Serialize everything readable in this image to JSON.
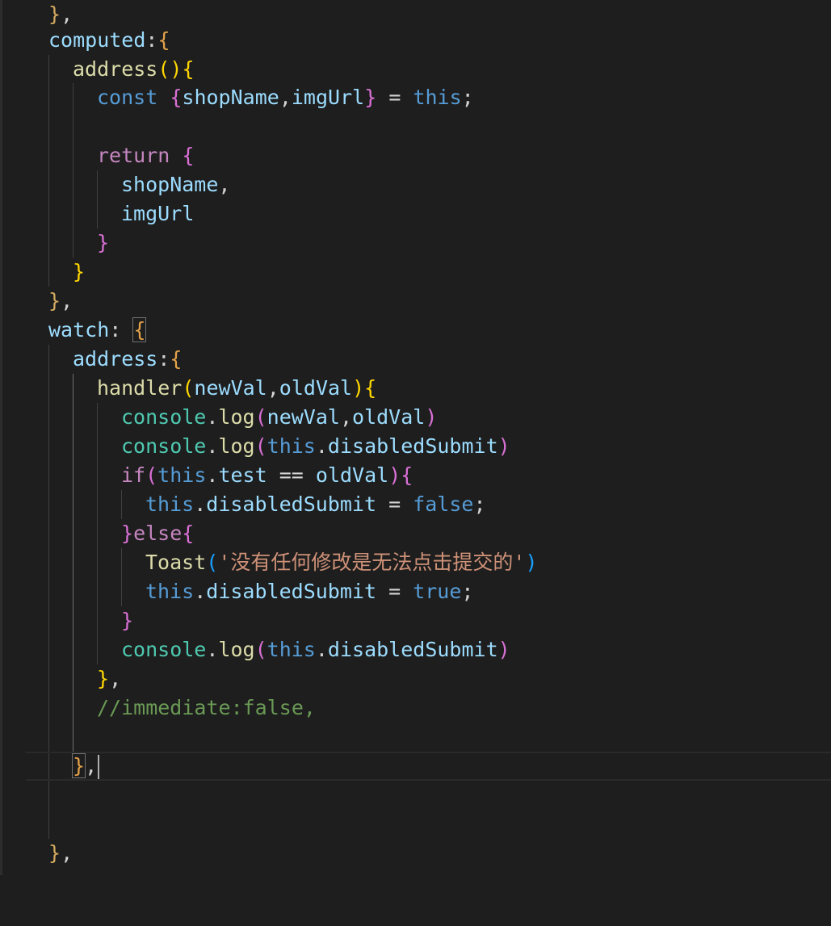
{
  "editor": {
    "language": "javascript",
    "theme": "dark",
    "cursor_line": 27,
    "lines": [
      "},",
      "computed:{",
      "address(){",
      "const {shopName,imgUrl} = this;",
      "",
      "return {",
      "shopName,",
      "imgUrl",
      "}",
      "}",
      "},",
      "watch: {",
      "address:{",
      "handler(newVal,oldVal){",
      "console.log(newVal,oldVal)",
      "console.log(this.disabledSubmit)",
      "if(this.test == oldVal){",
      "this.disabledSubmit = false;",
      "}else{",
      "Toast('没有任何修改是无法点击提交的')",
      "this.disabledSubmit = true;",
      "}",
      "console.log(this.disabledSubmit)",
      "},",
      "//immediate:false,",
      "",
      "},",
      "",
      "",
      "},"
    ]
  },
  "colors": {
    "background": "#1e1e1e",
    "keyword": "#569cd6",
    "control": "#c586c0",
    "variable": "#9cdcfe",
    "function": "#dcdcaa",
    "class": "#4ec9b0",
    "string": "#ce9178",
    "comment": "#6a9955"
  }
}
